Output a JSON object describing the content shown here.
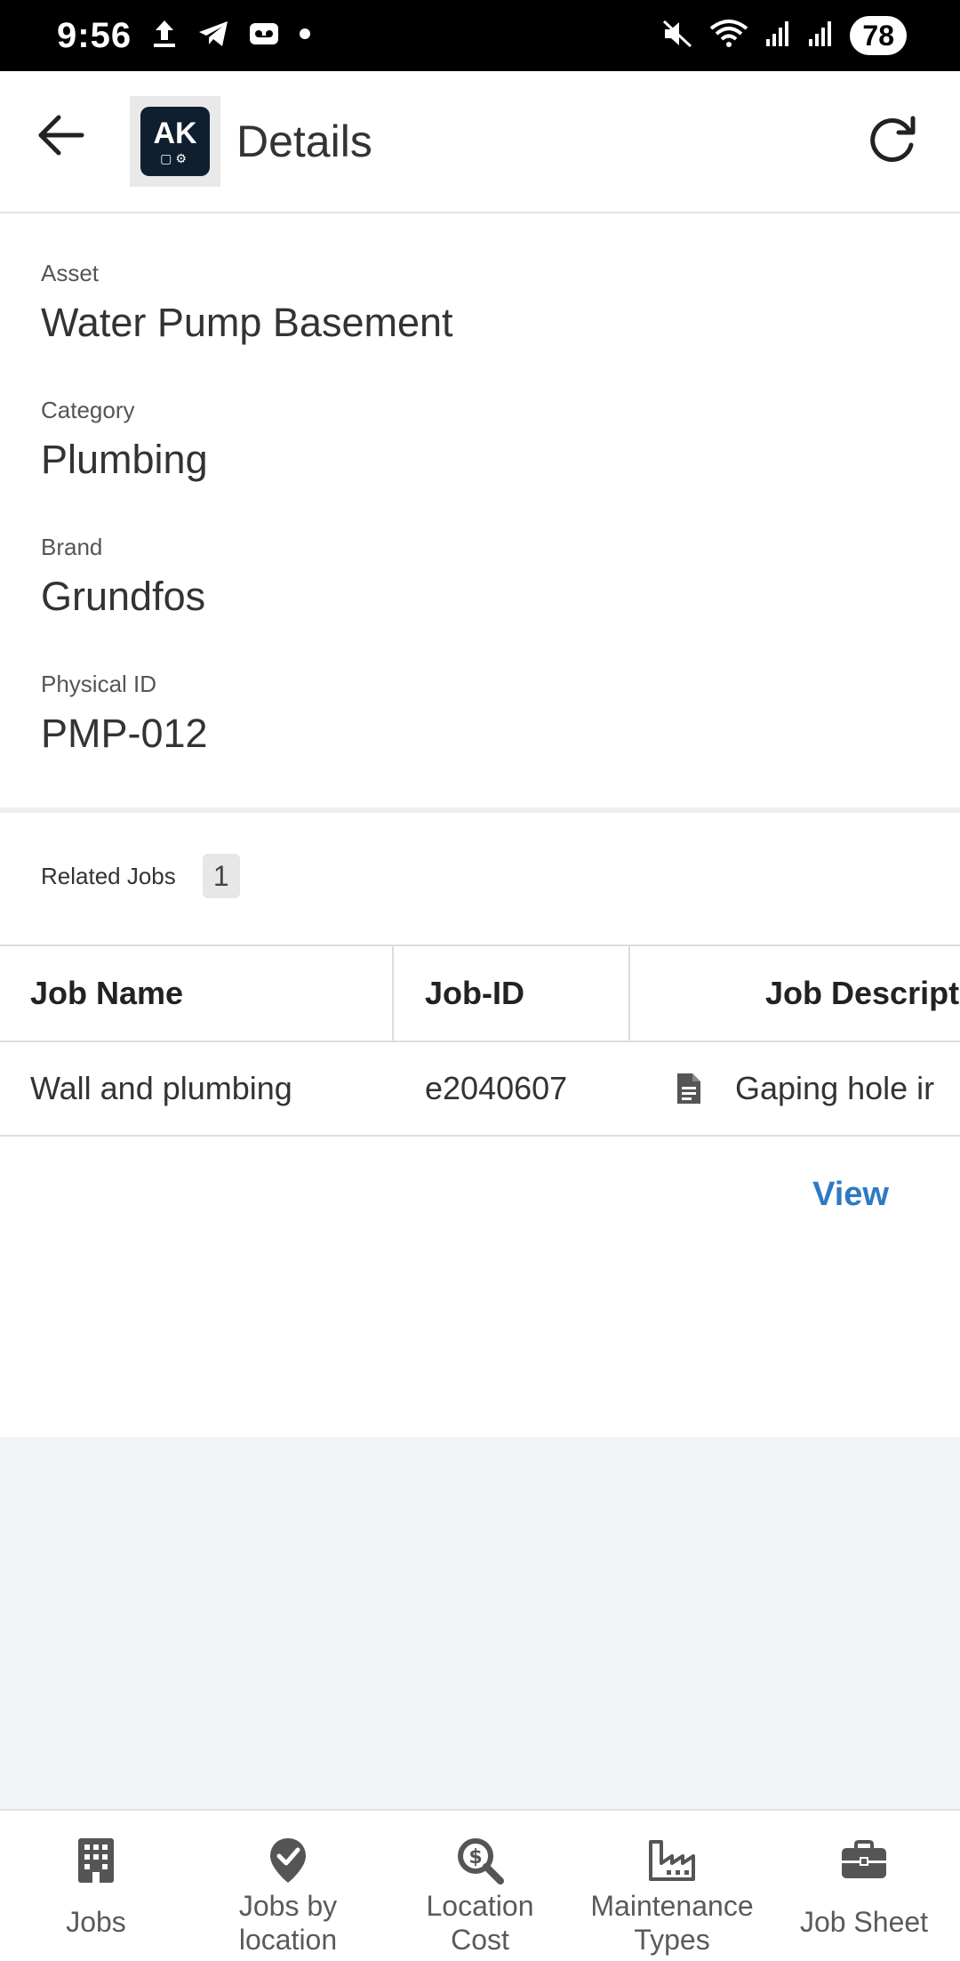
{
  "status_bar": {
    "time": "9:56",
    "battery": "78",
    "icons_left": [
      "upload-icon",
      "telegram-icon",
      "voicemail-icon",
      "dot-icon"
    ],
    "icons_right": [
      "mute-icon",
      "wifi-icon",
      "signal-icon",
      "signal-icon-2"
    ]
  },
  "app_bar": {
    "title": "Details",
    "logo_text": "AK",
    "back_icon": "back-arrow-icon",
    "refresh_icon": "refresh-icon"
  },
  "details": {
    "asset_label": "Asset",
    "asset_value": "Water Pump Basement",
    "category_label": "Category",
    "category_value": "Plumbing",
    "brand_label": "Brand",
    "brand_value": "Grundfos",
    "physical_id_label": "Physical ID",
    "physical_id_value": "PMP-012"
  },
  "related_jobs": {
    "label": "Related Jobs",
    "count": "1",
    "columns": [
      "Job Name",
      "Job-ID",
      "Job Descripti"
    ],
    "rows": [
      {
        "job_name": "Wall and plumbing",
        "job_id": "e2040607",
        "description": "Gaping hole ir"
      }
    ],
    "view_label": "View"
  },
  "bottom_nav": {
    "items": [
      {
        "label": "Jobs",
        "icon": "building-icon"
      },
      {
        "label": "Jobs by location",
        "icon": "location-check-icon"
      },
      {
        "label": "Location Cost",
        "icon": "search-dollar-icon"
      },
      {
        "label": "Maintenance Types",
        "icon": "factory-icon"
      },
      {
        "label": "Job Sheet",
        "icon": "briefcase-icon"
      }
    ]
  },
  "colors": {
    "accent": "#2f7ac2",
    "background": "#f2f3f7",
    "statusbar": "#000000"
  }
}
